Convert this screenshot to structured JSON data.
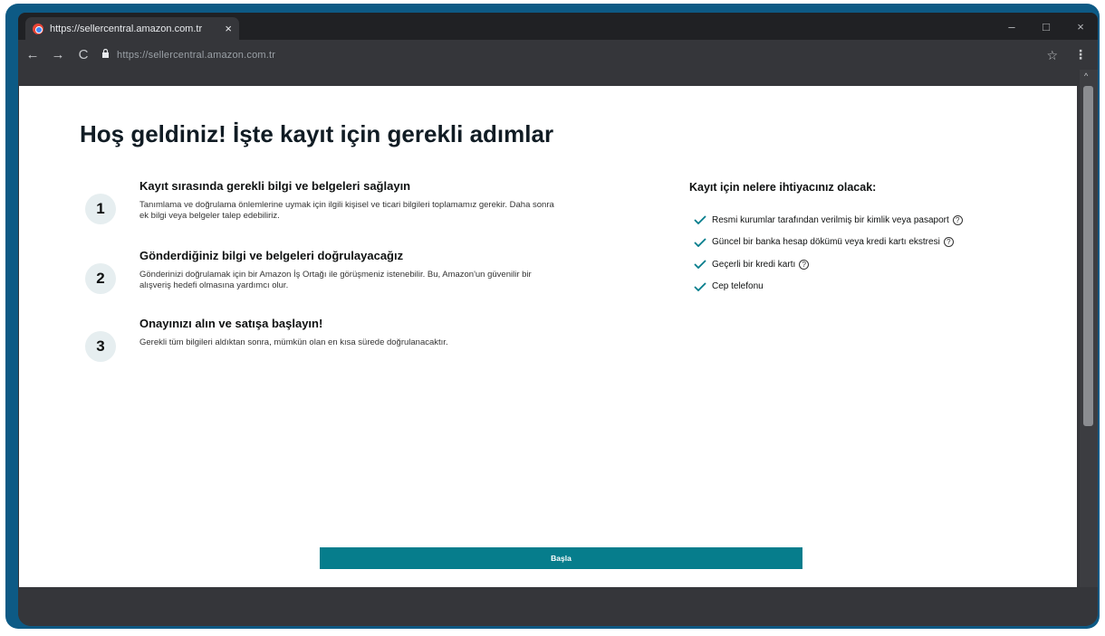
{
  "browser": {
    "tab_title": "https://sellercentral.amazon.com.tr",
    "tab_close": "×",
    "url": "https://sellercentral.amazon.com.tr",
    "window_controls": [
      "–",
      "□",
      "×"
    ],
    "nav": {
      "back": "←",
      "forward": "→",
      "reload": "C"
    },
    "icons": {
      "lock": "🔒",
      "star": "☆",
      "menu": "⋮",
      "scroll_up": "^"
    }
  },
  "page": {
    "title": "Hoş geldiniz! İşte kayıt için gerekli adımlar",
    "steps": [
      {
        "number": "1",
        "title": "Kayıt sırasında gerekli bilgi ve belgeleri sağlayın",
        "description": "Tanımlama ve doğrulama önlemlerine uymak için ilgili kişisel ve ticari bilgileri toplamamız gerekir. Daha sonra ek bilgi veya belgeler talep edebiliriz."
      },
      {
        "number": "2",
        "title": "Gönderdiğiniz bilgi ve belgeleri doğrulayacağız",
        "description": "Gönderinizi doğrulamak için bir Amazon İş Ortağı ile görüşmeniz istenebilir. Bu, Amazon'un güvenilir bir alışveriş hedefi olmasına yardımcı olur."
      },
      {
        "number": "3",
        "title": "Onayınızı alın ve satışa başlayın!",
        "description": "Gerekli tüm bilgileri aldıktan sonra, mümkün olan en kısa sürede doğrulanacaktır."
      }
    ],
    "requirements": {
      "title": "Kayıt için nelere ihtiyacınız olacak:",
      "items": [
        {
          "label": "Resmi kurumlar tarafından verilmiş bir kimlik veya pasaport",
          "help": "?"
        },
        {
          "label": "Güncel bir banka hesap dökümü veya kredi kartı ekstresi",
          "help": "?"
        },
        {
          "label": "Geçerli bir kredi kartı",
          "help": "?"
        },
        {
          "label": "Cep telefonu"
        }
      ]
    },
    "start_button": "Başla"
  },
  "colors": {
    "accent": "#067d8c",
    "check": "#067d8c",
    "frame": "#0d5a85",
    "chrome": "#35363a"
  }
}
